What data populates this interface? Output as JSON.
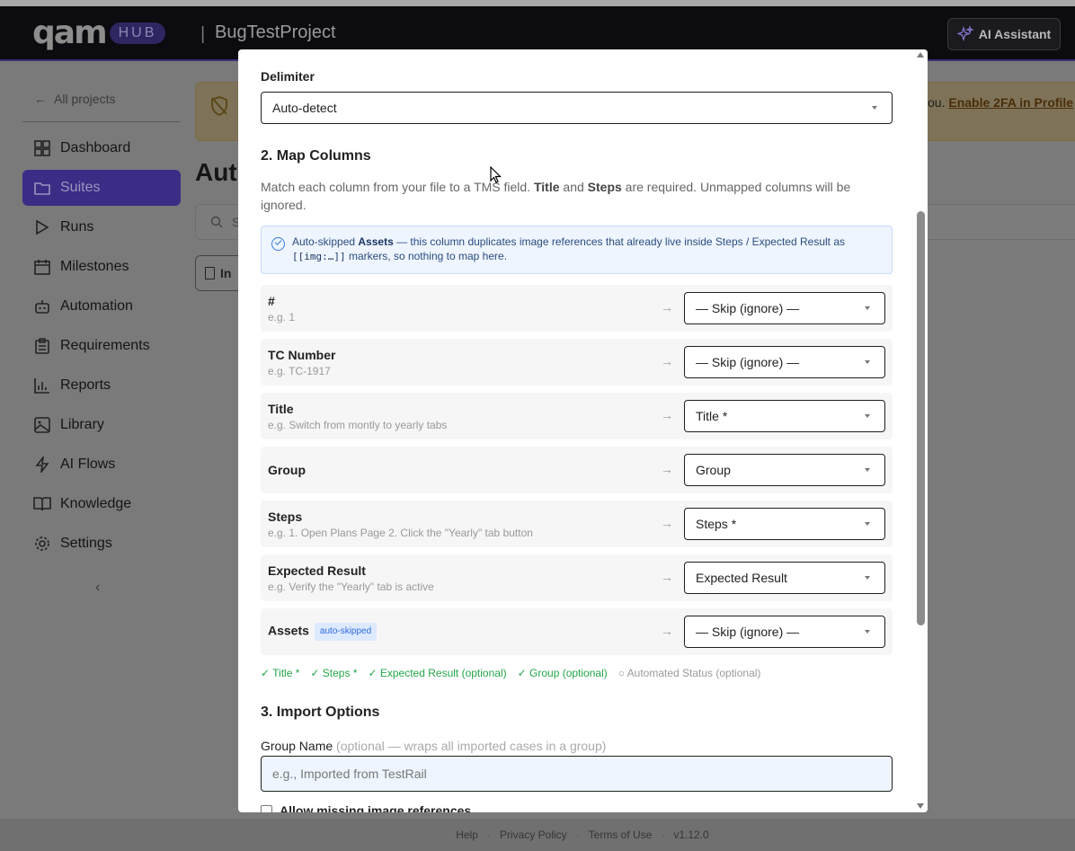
{
  "header": {
    "logo_text": "qam",
    "hub_label": "HUB",
    "separator": "|",
    "project_name": "BugTestProject",
    "ai_button": "AI Assistant"
  },
  "sidebar": {
    "back_label": "All projects",
    "items": [
      {
        "label": "Dashboard",
        "icon": "grid-icon"
      },
      {
        "label": "Suites",
        "icon": "folder-icon",
        "active": true
      },
      {
        "label": "Runs",
        "icon": "play-icon"
      },
      {
        "label": "Milestones",
        "icon": "calendar-icon"
      },
      {
        "label": "Automation",
        "icon": "robot-icon"
      },
      {
        "label": "Requirements",
        "icon": "clipboard-icon"
      },
      {
        "label": "Reports",
        "icon": "bar-chart-icon"
      },
      {
        "label": "Library",
        "icon": "image-icon"
      },
      {
        "label": "AI Flows",
        "icon": "lightning-icon"
      },
      {
        "label": "Knowledge",
        "icon": "book-icon"
      },
      {
        "label": "Settings",
        "icon": "gear-icon"
      }
    ],
    "collapse_glyph": "‹"
  },
  "background": {
    "banner_tail": "ou.",
    "banner_link": "Enable 2FA in Profile",
    "heading_partial": "Aut",
    "search_partial": "S",
    "button_partial": "In"
  },
  "footer": {
    "links": [
      "Help",
      "Privacy Policy",
      "Terms of Use"
    ],
    "version": "v1.12.0"
  },
  "modal": {
    "delimiter_label": "Delimiter",
    "delimiter_value": "Auto-detect",
    "section2_title": "2. Map Columns",
    "section2_desc_parts": [
      "Match each column from your file to a TMS field. ",
      "Title",
      " and ",
      "Steps",
      " are required. Unmapped columns will be ignored."
    ],
    "info": {
      "prefix": "Auto-skipped ",
      "bold": "Assets",
      "middle": " — this column duplicates image references that already live inside Steps / Expected Result as ",
      "code": "[[img:…]]",
      "suffix": " markers, so nothing to map here."
    },
    "mapping_rows": [
      {
        "column": "#",
        "example": "e.g. 1",
        "target": "— Skip (ignore) —"
      },
      {
        "column": "TC Number",
        "example": "e.g. TC-1917",
        "target": "— Skip (ignore) —"
      },
      {
        "column": "Title",
        "example": "e.g. Switch from montly to yearly tabs",
        "target": "Title *"
      },
      {
        "column": "Group",
        "example": "",
        "target": "Group"
      },
      {
        "column": "Steps",
        "example": "e.g. 1. Open Plans Page 2. Click the \"Yearly\" tab button",
        "target": "Steps *"
      },
      {
        "column": "Expected Result",
        "example": "e.g. Verify the \"Yearly\" tab is active",
        "target": "Expected Result"
      },
      {
        "column": "Assets",
        "example": "",
        "target": "— Skip (ignore) —",
        "badge": "auto-skipped"
      }
    ],
    "arrow_glyph": "→",
    "field_checks": [
      {
        "label": "✓ Title *",
        "state": "ok"
      },
      {
        "label": "✓ Steps *",
        "state": "ok"
      },
      {
        "label": "✓ Expected Result (optional)",
        "state": "ok"
      },
      {
        "label": "✓ Group (optional)",
        "state": "ok"
      },
      {
        "label": "○ Automated Status (optional)",
        "state": "off"
      }
    ],
    "section3_title": "3. Import Options",
    "group_name_label": "Group Name",
    "group_name_hint": "(optional — wraps all imported cases in a group)",
    "group_name_placeholder": "e.g., Imported from TestRail",
    "allow_missing_label": "Allow missing image references"
  },
  "colors": {
    "accent": "#3b2c86",
    "success": "#23a548",
    "info_bg": "#eef5ff"
  }
}
